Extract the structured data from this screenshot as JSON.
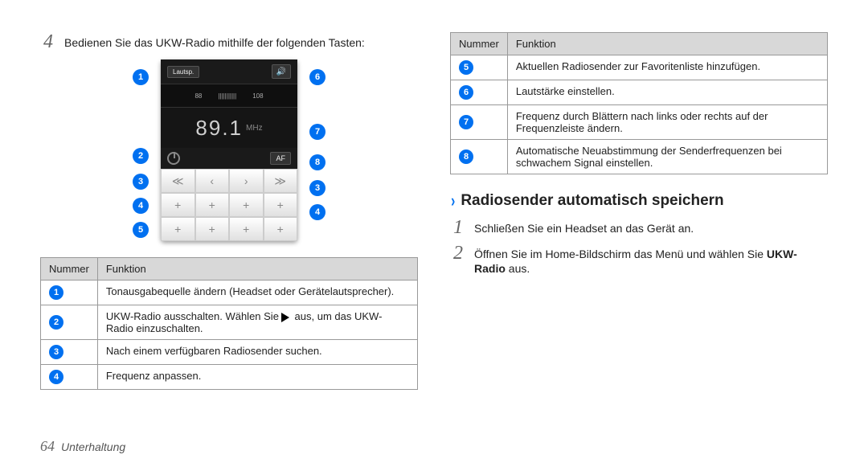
{
  "left": {
    "step4_num": "4",
    "step4_text": "Bedienen Sie das UKW-Radio mithilfe der folgenden Tasten:",
    "radio": {
      "lautsp": "Lautsp.",
      "dial_left": "88",
      "dial_right": "108",
      "freq": "89.1",
      "mhz": "MHz",
      "af": "AF"
    },
    "callouts_left": [
      "1",
      "2",
      "3",
      "4",
      "5"
    ],
    "callouts_right": [
      "6",
      "7",
      "8",
      "3",
      "4"
    ],
    "table1": {
      "h1": "Nummer",
      "h2": "Funktion",
      "rows": [
        {
          "n": "1",
          "t": "Tonausgabequelle ändern (Headset oder Gerätelautsprecher)."
        },
        {
          "n": "2",
          "t": "UKW-Radio ausschalten. Wählen Sie",
          "t2": " aus, um das UKW-Radio einzuschalten."
        },
        {
          "n": "3",
          "t": "Nach einem verfügbaren Radiosender suchen."
        },
        {
          "n": "4",
          "t": "Frequenz anpassen."
        }
      ]
    }
  },
  "right": {
    "table2": {
      "h1": "Nummer",
      "h2": "Funktion",
      "rows": [
        {
          "n": "5",
          "t": "Aktuellen Radiosender zur Favoritenliste hinzufügen."
        },
        {
          "n": "6",
          "t": "Lautstärke einstellen."
        },
        {
          "n": "7",
          "t": "Frequenz durch Blättern nach links oder rechts auf der Frequenzleiste ändern."
        },
        {
          "n": "8",
          "t": "Automatische Neuabstimmung der Senderfrequenzen bei schwachem Signal einstellen."
        }
      ]
    },
    "section_title": "Radiosender automatisch speichern",
    "step1_num": "1",
    "step1_text": "Schließen Sie ein Headset an das Gerät an.",
    "step2_num": "2",
    "step2_text_a": "Öffnen Sie im Home-Bildschirm das Menü und wählen Sie ",
    "step2_text_b": "UKW-Radio",
    "step2_text_c": " aus."
  },
  "footer": {
    "page": "64",
    "section": "Unterhaltung"
  }
}
